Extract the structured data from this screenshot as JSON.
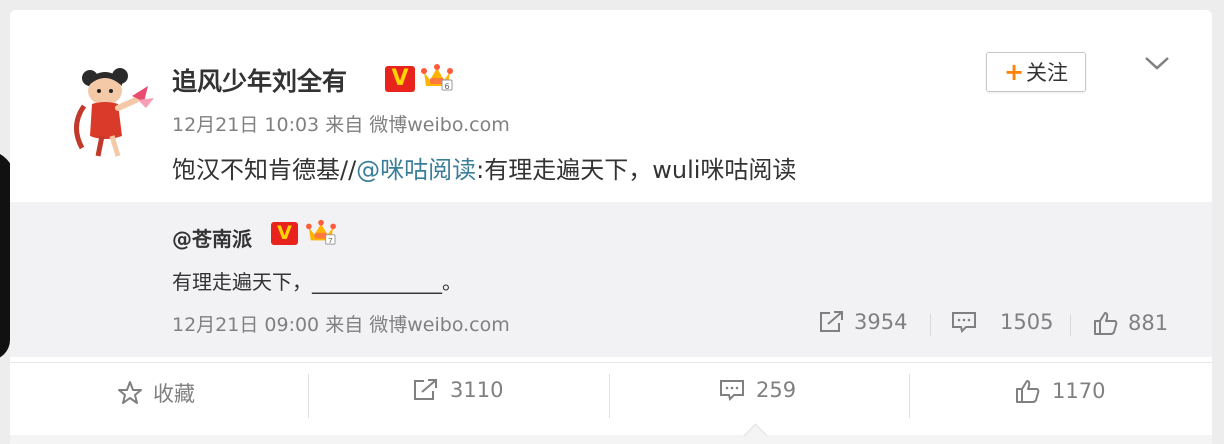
{
  "post": {
    "author_name": "追风少年刘全有",
    "verified_glyph": "V",
    "meta": {
      "date": "12月21日 10:03",
      "source_prefix": "来自",
      "source": "微博weibo.com"
    },
    "content": {
      "text_before": "饱汉不知肯德基//",
      "mention": "@咪咕阅读",
      "text_after": ":有理走遍天下，wuli咪咕阅读"
    },
    "follow_button": {
      "plus": "+",
      "label": "关注"
    }
  },
  "repost": {
    "author": "@苍南派",
    "verified_glyph": "V",
    "text": "有理走遍天下，_____________。",
    "meta": {
      "date": "12月21日 09:00",
      "source_prefix": "来自",
      "source": "微博weibo.com"
    },
    "stats": {
      "forward": "3954",
      "comment": "1505",
      "like": "881"
    }
  },
  "actions": {
    "favorite": "收藏",
    "forward": "3110",
    "comment": "259",
    "like": "1170"
  },
  "colors": {
    "vip_red": "#e8231d",
    "follow_plus": "#ff8200",
    "mention": "#3b7e9a",
    "meta_gray": "#808080"
  }
}
